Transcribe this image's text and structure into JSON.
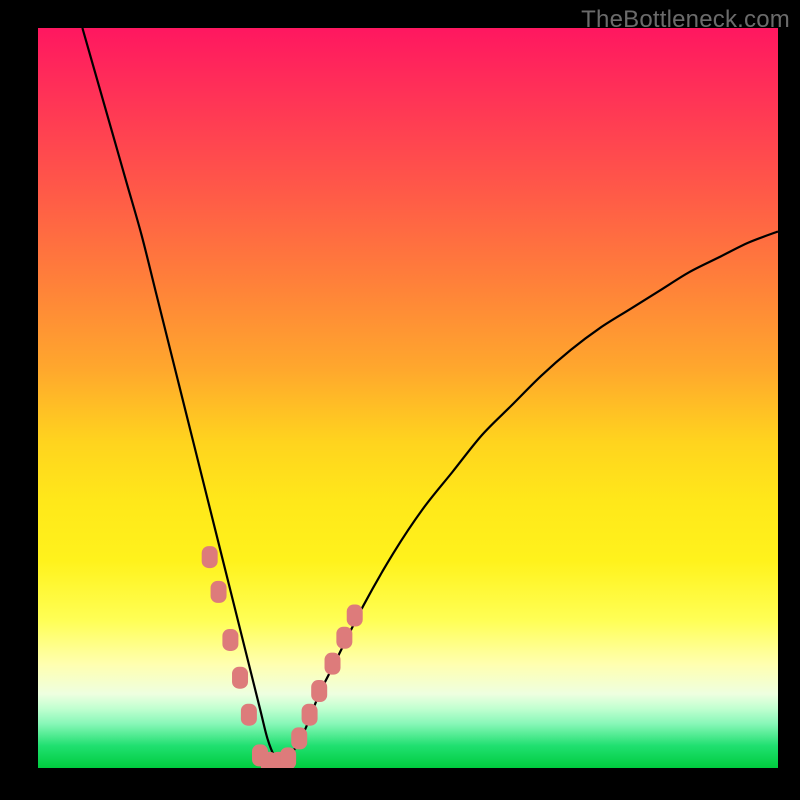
{
  "watermark": "TheBottleneck.com",
  "chart_data": {
    "type": "line",
    "title": "",
    "xlabel": "",
    "ylabel": "",
    "xlim": [
      0,
      100
    ],
    "ylim": [
      0,
      100
    ],
    "background_gradient": {
      "orientation": "vertical",
      "top_color": "#ff1760",
      "bottom_color": "#00cc3e",
      "stops": [
        {
          "pos": 0,
          "color": "#ff1760"
        },
        {
          "pos": 0.08,
          "color": "#ff2f58"
        },
        {
          "pos": 0.22,
          "color": "#ff5948"
        },
        {
          "pos": 0.34,
          "color": "#ff7f3a"
        },
        {
          "pos": 0.46,
          "color": "#ffa72d"
        },
        {
          "pos": 0.56,
          "color": "#ffd41e"
        },
        {
          "pos": 0.64,
          "color": "#ffe81a"
        },
        {
          "pos": 0.72,
          "color": "#fff21c"
        },
        {
          "pos": 0.8,
          "color": "#ffff55"
        },
        {
          "pos": 0.86,
          "color": "#ffffb0"
        },
        {
          "pos": 0.9,
          "color": "#eeffe0"
        },
        {
          "pos": 0.92,
          "color": "#c0ffd0"
        },
        {
          "pos": 0.94,
          "color": "#88f7b8"
        },
        {
          "pos": 0.97,
          "color": "#20e070"
        },
        {
          "pos": 1.0,
          "color": "#00cc3e"
        }
      ]
    },
    "series": [
      {
        "name": "bottleneck-curve",
        "color": "#000000",
        "x": [
          6,
          8,
          10,
          12,
          14,
          16,
          18,
          20,
          22,
          24,
          26,
          28,
          30,
          31,
          32,
          33,
          34,
          36,
          38,
          40,
          44,
          48,
          52,
          56,
          60,
          64,
          68,
          72,
          76,
          80,
          84,
          88,
          92,
          96,
          100
        ],
        "y": [
          100,
          93,
          86,
          79,
          72,
          64,
          56,
          48,
          40,
          32,
          24,
          16,
          8,
          4,
          1.5,
          0.5,
          1.5,
          5,
          10,
          14,
          22,
          29,
          35,
          40,
          45,
          49,
          53,
          56.5,
          59.5,
          62,
          64.5,
          67,
          69,
          71,
          72.5
        ]
      }
    ],
    "markers": {
      "name": "highlighted-points",
      "shape": "rounded-rect",
      "color": "#dd7b7b",
      "points_x": [
        23.2,
        24.4,
        26.0,
        27.3,
        28.5,
        30.0,
        31.2,
        32.5,
        33.8,
        35.3,
        36.7,
        38.0,
        39.8,
        41.4,
        42.8
      ],
      "points_y": [
        28.5,
        23.8,
        17.3,
        12.2,
        7.2,
        1.7,
        0.7,
        0.7,
        1.3,
        4.0,
        7.2,
        10.4,
        14.1,
        17.6,
        20.6
      ]
    }
  }
}
